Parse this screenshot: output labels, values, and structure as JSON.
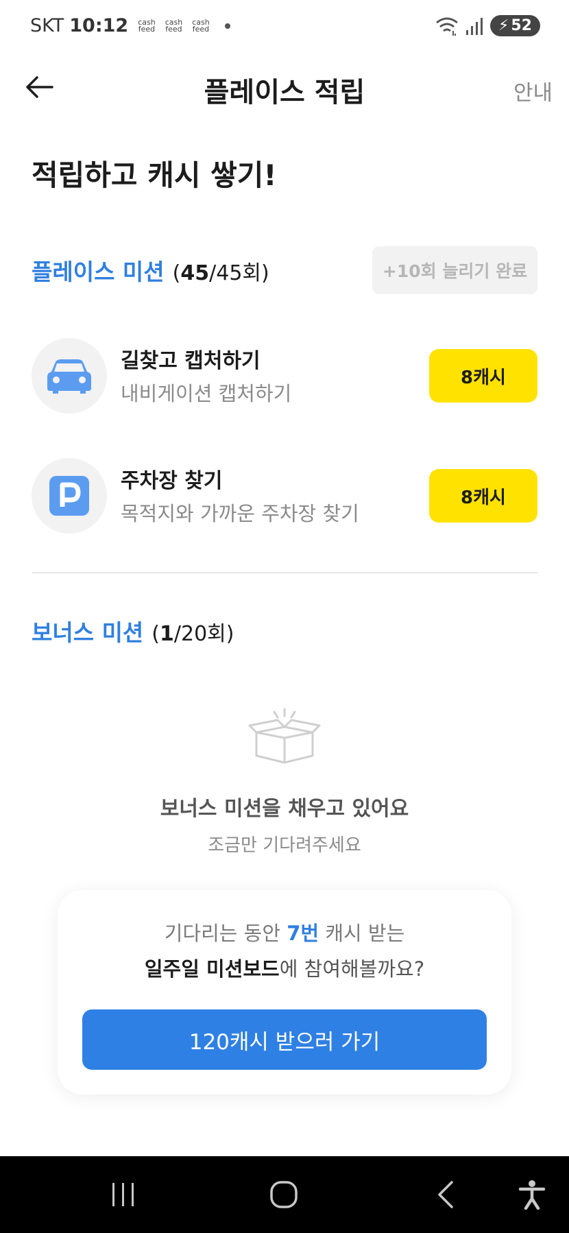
{
  "status_bar": {
    "carrier": "SKT",
    "time": "10:12",
    "notif_top": "cash",
    "notif_bottom": "feed",
    "battery": "52"
  },
  "header": {
    "title": "플레이스 적립",
    "guide_label": "안내"
  },
  "headline": "적립하고 캐시 쌓기!",
  "place_mission": {
    "title": "플레이스 미션",
    "count_open": "(",
    "count_done": "45",
    "count_rest": "/45회)",
    "extend_label": "+10회 늘리기 완료",
    "items": [
      {
        "title": "길찾고 캡처하기",
        "desc": "내비게이션 캡처하기",
        "reward": "8캐시",
        "icon": "car-icon"
      },
      {
        "title": "주차장 찾기",
        "desc": "목적지와 가까운 주차장 찾기",
        "reward": "8캐시",
        "icon": "parking-icon"
      }
    ]
  },
  "bonus_mission": {
    "title": "보너스 미션",
    "count_open": "(",
    "count_done": "1",
    "count_rest": "/20회)",
    "empty_title": "보너스 미션을 채우고 있어요",
    "empty_sub": "조금만 기다려주세요",
    "icon": "open-box-icon"
  },
  "promo": {
    "line1_pre": "기다리는 동안 ",
    "line1_hl": "7번",
    "line1_post": " 캐시 받는",
    "line2_bold": "일주일 미션보드",
    "line2_rest": "에 참여해볼까요?",
    "button_label": "120캐시 받으러 가기"
  },
  "colors": {
    "accent_blue": "#2f7fe0",
    "reward_yellow": "#ffe200",
    "icon_blue": "#5b9cf0"
  }
}
